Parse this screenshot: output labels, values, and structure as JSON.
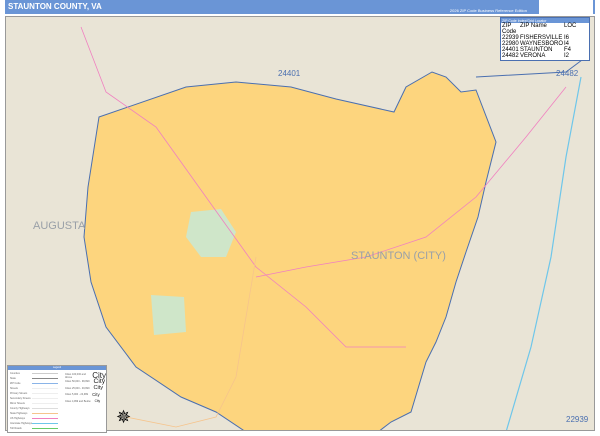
{
  "header": {
    "title": "STAUNTON COUNTY, VA",
    "edition": "2026 ZIP Code Business Reference Edition",
    "logo": "MarketMAPS"
  },
  "locator": {
    "title": "ZIP Code Index/Grid Locator",
    "columns": [
      "ZIP Code",
      "ZIP Name",
      "LOC"
    ],
    "rows": [
      [
        "22939",
        "FISHERSVILLE",
        "I6"
      ],
      [
        "22980",
        "WAYNESBORO",
        "I4"
      ],
      [
        "24401",
        "STAUNTON",
        "F4"
      ],
      [
        "24482",
        "VERONA",
        "I2"
      ]
    ]
  },
  "map_labels": {
    "zip_24401": "24401",
    "zip_24482": "24482",
    "zip_22939": "22939",
    "county": "AUGUSTA",
    "city": "STAUNTON (CITY)"
  },
  "colors": {
    "city_fill": "#fdd57e",
    "background": "#e9e4d6",
    "zip_boundary": "#4a6fb0",
    "header": "#6a95d6",
    "park": "#cfe6c9"
  },
  "legend": {
    "title": "Legend",
    "items": [
      {
        "label": "Counties",
        "color": "#cccccc"
      },
      {
        "label": "State",
        "color": "#888888"
      },
      {
        "label": "ZIP Code",
        "color": "#8ab4e8"
      },
      {
        "label": "Streets",
        "color": "#eeeeee"
      },
      {
        "label": "Primary Streets",
        "color": "#eeeeee"
      },
      {
        "label": "Secondary Streets",
        "color": "#eeeeee"
      },
      {
        "label": "Minor Streets",
        "color": "#eeeeee"
      },
      {
        "label": "County Highways",
        "color": "#dddddd"
      },
      {
        "label": "State Highways",
        "color": "#f6c48c"
      },
      {
        "label": "US Highways",
        "color": "#f080c0"
      },
      {
        "label": "Interstate Highways",
        "color": "#6ec6ea"
      },
      {
        "label": "Toll Roads",
        "color": "#66cc66"
      }
    ],
    "population": [
      {
        "label": "Cities 100,000 and Above",
        "sample": "City"
      },
      {
        "label": "Cities 50,000 - 99,999",
        "sample": "City"
      },
      {
        "label": "Cities 25,000 - 49,999",
        "sample": "City"
      },
      {
        "label": "Cities 5,000 - 24,999",
        "sample": "City"
      },
      {
        "label": "Cities 4,999 and Below",
        "sample": "City"
      }
    ]
  }
}
